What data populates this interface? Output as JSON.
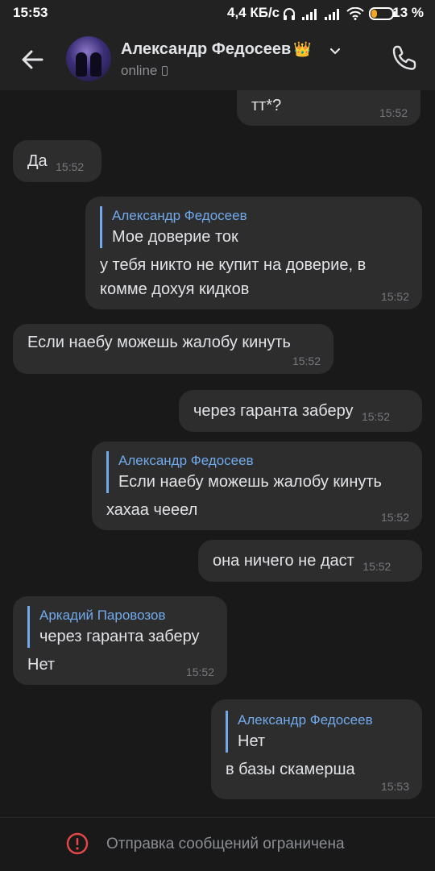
{
  "status_bar": {
    "time": "15:53",
    "network_speed": "4,4 КБ/с",
    "battery": "13 %"
  },
  "header": {
    "name": "Александр Федосеев",
    "badge": "👑",
    "status": "online"
  },
  "messages": [
    {
      "text": "тт*?",
      "time": "15:52"
    },
    {
      "text": "Да",
      "time": "15:52"
    },
    {
      "quote_name": "Александр Федосеев",
      "quote_text": "Мое доверие ток",
      "text_line1": "у тебя никто не купит на доверие, в",
      "text_line2": "комме дохуя кидков",
      "time": "15:52"
    },
    {
      "text": "Если наебу можешь жалобу кинуть",
      "time": "15:52"
    },
    {
      "text": "через гаранта заберу",
      "time": "15:52"
    },
    {
      "quote_name": "Александр Федосеев",
      "quote_text": "Если наебу можешь жалобу кинуть",
      "text": "хахаа чееел",
      "time": "15:52"
    },
    {
      "text": "она ничего не даст",
      "time": "15:52"
    },
    {
      "quote_name": "Аркадий Паровозов",
      "quote_text": "через гаранта заберу",
      "text": "Нет",
      "time": "15:52"
    },
    {
      "quote_name": "Александр Федосеев",
      "quote_text": "Нет",
      "text": "в базы скамерша",
      "time": "15:53"
    }
  ],
  "footer": {
    "notice": "Отправка сообщений ограничена"
  },
  "colors": {
    "background": "#19191a",
    "bubble": "#2d2d2e",
    "accent": "#71aaeb",
    "warning": "#e64646"
  }
}
